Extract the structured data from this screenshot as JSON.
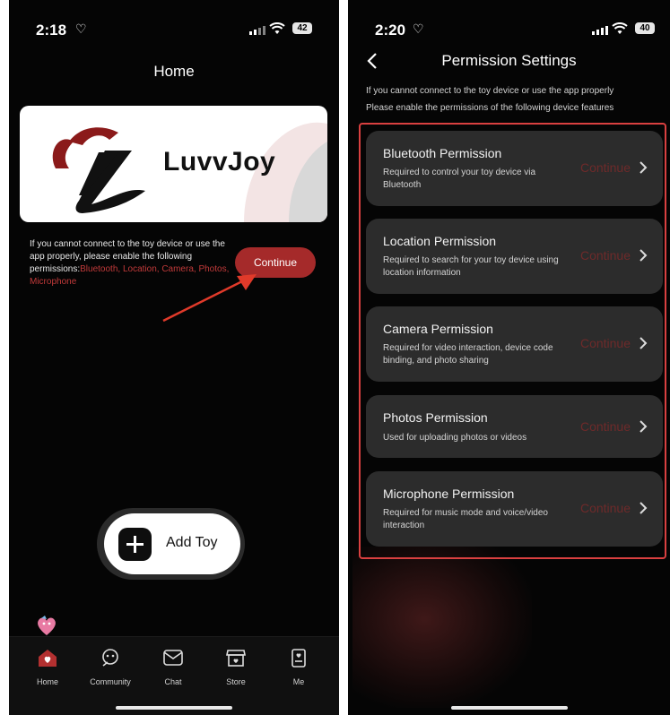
{
  "left": {
    "status": {
      "time": "2:18",
      "battery": "42"
    },
    "title": "Home",
    "banner": {
      "brand": "LuvvJoy"
    },
    "note": {
      "text": "If you cannot connect to the toy device or use the app properly, please enable the following permissions:",
      "highlight": "Bluetooth, Location, Camera, Photos, Microphone"
    },
    "continue_label": "Continue",
    "add_toy_label": "Add Toy",
    "tabs": [
      {
        "label": "Home",
        "icon": "home-icon"
      },
      {
        "label": "Community",
        "icon": "community-icon"
      },
      {
        "label": "Chat",
        "icon": "chat-icon"
      },
      {
        "label": "Store",
        "icon": "store-icon"
      },
      {
        "label": "Me",
        "icon": "me-icon"
      }
    ]
  },
  "right": {
    "status": {
      "time": "2:20",
      "battery": "40"
    },
    "title": "Permission Settings",
    "note_line1": "If you cannot connect to the toy device or use the app properly",
    "note_line2": "Please enable the permissions of the following device features",
    "permissions": [
      {
        "title": "Bluetooth Permission",
        "desc": "Required to control your toy device via Bluetooth",
        "action": "Continue"
      },
      {
        "title": "Location Permission",
        "desc": "Required to search for your toy device using location information",
        "action": "Continue"
      },
      {
        "title": "Camera Permission",
        "desc": "Required for video interaction, device code binding, and photo sharing",
        "action": "Continue"
      },
      {
        "title": "Photos Permission",
        "desc": "Used for uploading photos or videos",
        "action": "Continue"
      },
      {
        "title": "Microphone Permission",
        "desc": "Required for music mode and voice/video interaction",
        "action": "Continue"
      }
    ]
  },
  "colors": {
    "accent_red": "#a52a2a",
    "link_red": "#c23a3a",
    "highlight_border": "#d94040",
    "card_bg": "#2c2c2c"
  }
}
